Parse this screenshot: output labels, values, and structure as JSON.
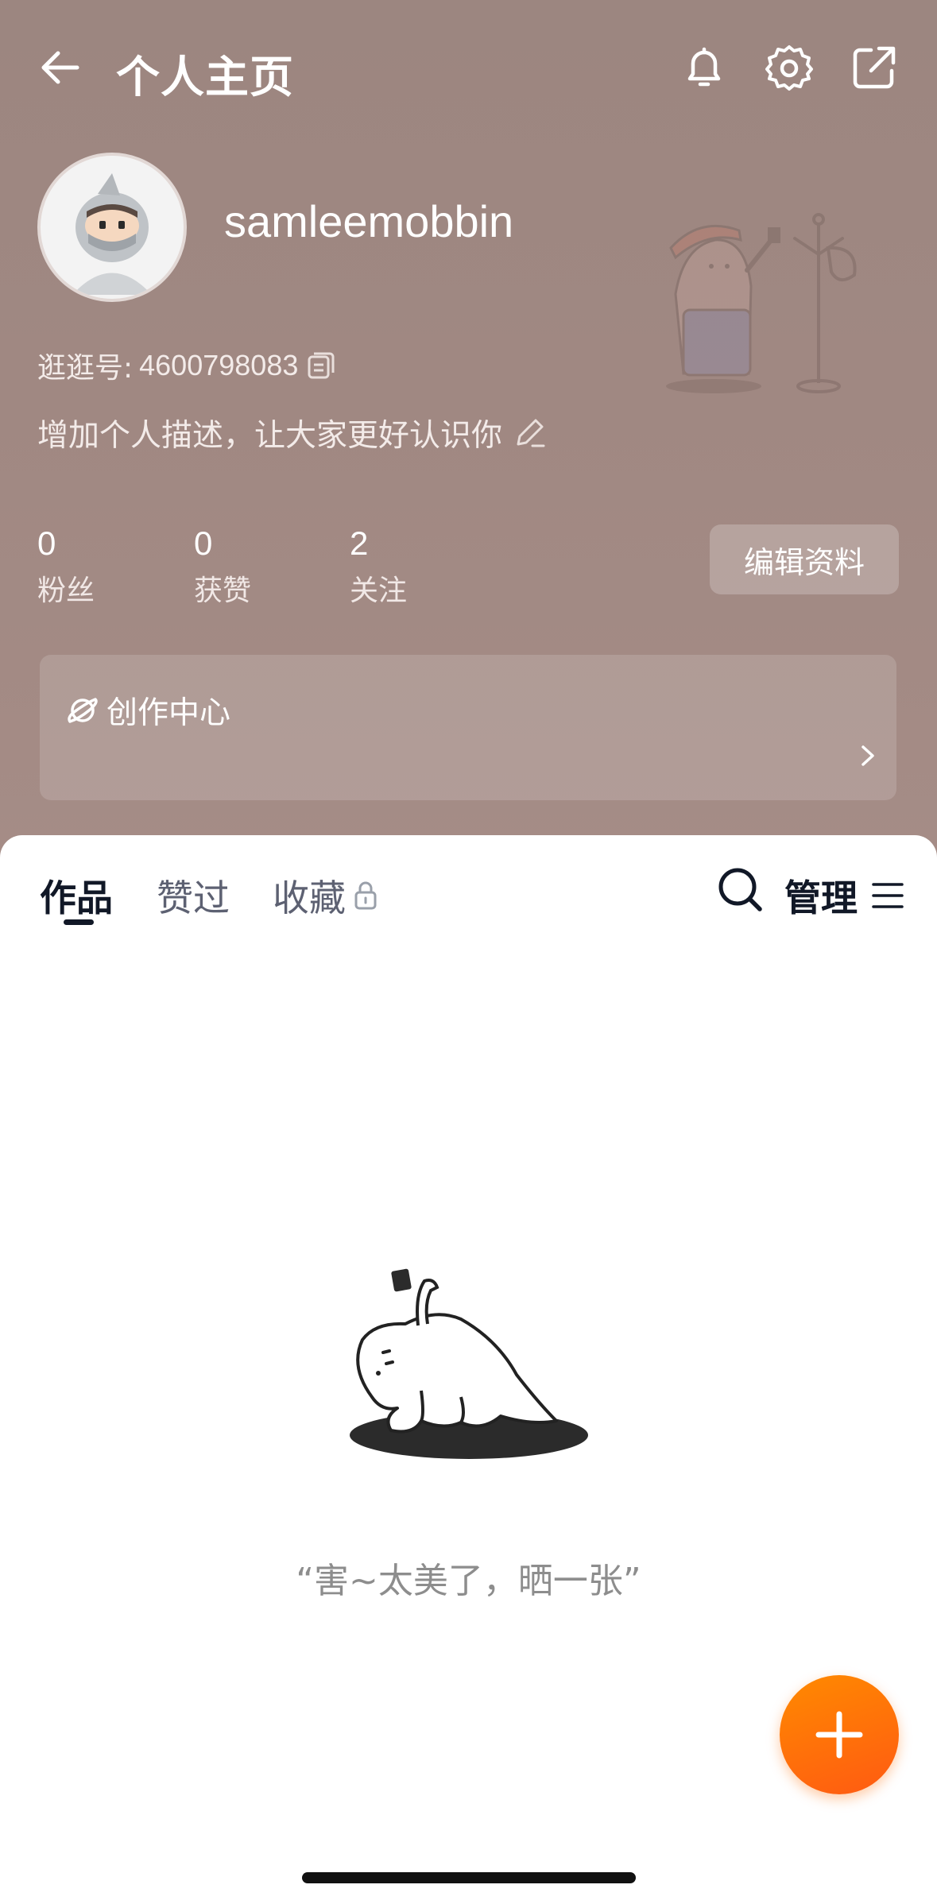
{
  "header": {
    "title": "个人主页",
    "icons": [
      "back-arrow-icon",
      "bell-icon",
      "gear-icon",
      "share-icon"
    ]
  },
  "profile": {
    "username": "samleemobbin",
    "id_label": "逛逛号:",
    "id_value": "4600798083",
    "description": "增加个人描述，让大家更好认识你"
  },
  "stats": [
    {
      "value": "0",
      "label": "粉丝"
    },
    {
      "value": "0",
      "label": "获赞"
    },
    {
      "value": "2",
      "label": "关注"
    }
  ],
  "edit_profile_label": "编辑资料",
  "creator_center": {
    "label": "创作中心"
  },
  "tabs": [
    {
      "label": "作品",
      "active": true
    },
    {
      "label": "赞过",
      "active": false
    },
    {
      "label": "收藏",
      "active": false,
      "locked": true
    }
  ],
  "manage_label": "管理",
  "empty_state": {
    "text": "“害~太美了，晒一张”"
  },
  "colors": {
    "header_bg": "#a08882",
    "accent_orange": "#ff6a00",
    "text_dark": "#111827"
  }
}
